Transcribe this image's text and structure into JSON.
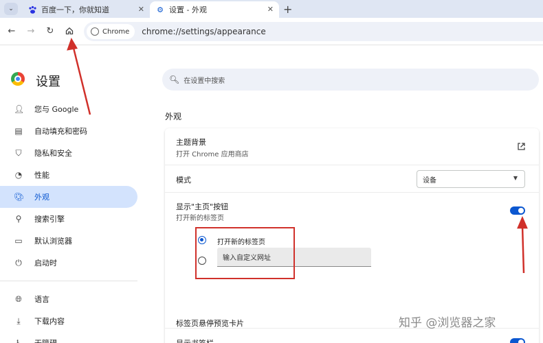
{
  "tabs": [
    {
      "title": "百度一下，你就知道",
      "favicon": "baidu-paw-icon"
    },
    {
      "title": "设置 - 外观",
      "favicon": "gear-icon",
      "active": true
    }
  ],
  "toolbar": {
    "chip_label": "Chrome",
    "url": "chrome://settings/appearance"
  },
  "settings": {
    "title": "设置",
    "search_placeholder": "在设置中搜索"
  },
  "nav": [
    {
      "label": "您与 Google",
      "icon": "person-icon"
    },
    {
      "label": "自动填充和密码",
      "icon": "clipboard-icon"
    },
    {
      "label": "隐私和安全",
      "icon": "shield-icon"
    },
    {
      "label": "性能",
      "icon": "gauge-icon"
    },
    {
      "label": "外观",
      "icon": "palette-icon",
      "active": true
    },
    {
      "label": "搜索引擎",
      "icon": "search-icon"
    },
    {
      "label": "默认浏览器",
      "icon": "browser-icon"
    },
    {
      "label": "启动时",
      "icon": "power-icon"
    },
    {
      "label": "语言",
      "icon": "globe-icon"
    },
    {
      "label": "下载内容",
      "icon": "download-icon"
    },
    {
      "label": "无障碍",
      "icon": "accessibility-icon"
    }
  ],
  "appearance": {
    "section_title": "外观",
    "theme_title": "主题背景",
    "theme_subtitle": "打开 Chrome 应用商店",
    "mode_label": "模式",
    "mode_value": "设备",
    "home_title": "显示\"主页\"按钮",
    "home_subtitle": "打开新的标签页",
    "home_enabled": true,
    "radio_new_tab": "打开新的标签页",
    "radio_custom_placeholder": "输入自定义网址",
    "bookmarks_label": "显示书签栏",
    "bookmarks_enabled": true,
    "hover_preview_label": "标签页悬停预览卡片"
  },
  "watermark": "知乎 @浏览器之家",
  "colors": {
    "accent": "#0b57d0",
    "annotation": "#d0302a"
  }
}
